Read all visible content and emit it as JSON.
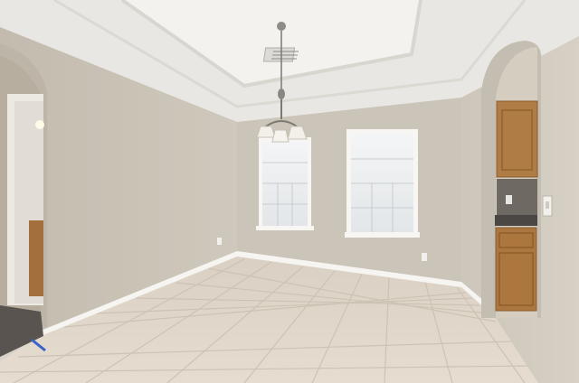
{
  "scene": {
    "type": "empty-dining-room",
    "features": [
      "tray-ceiling",
      "chandelier",
      "two-windows",
      "arched-doorways",
      "tile-floor",
      "kitchen-cabinets"
    ]
  },
  "colors": {
    "wall": "#cbc4b8",
    "wall_shadow": "#b9b1a5",
    "ceiling": "#ebe9e5",
    "tray": "#f4f3f1",
    "trim": "#f6f5f2",
    "floor": "#ded5c8",
    "grout": "#cfc5b7",
    "window_glass": "#dfe3e6",
    "cabinet": "#b07c45",
    "hall_floor": "#5a5450"
  }
}
